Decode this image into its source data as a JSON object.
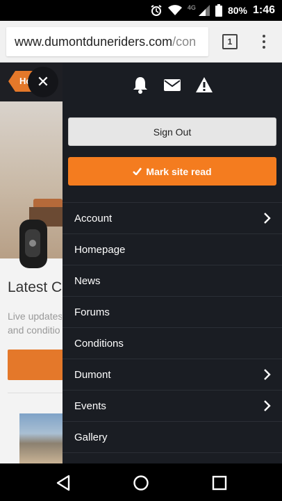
{
  "status_bar": {
    "network_label": "4G",
    "battery_percent": "80%",
    "time": "1:46"
  },
  "browser": {
    "url_main": "www.dumontduneriders.com",
    "url_path": "/con",
    "tab_count": "1"
  },
  "page": {
    "home_label": "Ho",
    "latest_heading": "Latest C",
    "latest_sub_line1": "Live updates",
    "latest_sub_line2": "and conditio"
  },
  "menu": {
    "icons": [
      "bell-icon",
      "envelope-icon",
      "warning-icon"
    ],
    "sign_out_label": "Sign Out",
    "mark_read_label": "Mark site read",
    "items": [
      {
        "label": "Account",
        "has_submenu": true
      },
      {
        "label": "Homepage",
        "has_submenu": false
      },
      {
        "label": "News",
        "has_submenu": false
      },
      {
        "label": "Forums",
        "has_submenu": false
      },
      {
        "label": "Conditions",
        "has_submenu": false
      },
      {
        "label": "Dumont",
        "has_submenu": true
      },
      {
        "label": "Events",
        "has_submenu": true
      },
      {
        "label": "Gallery",
        "has_submenu": false
      }
    ]
  },
  "colors": {
    "menu_bg": "#1a1d23",
    "accent_orange": "#f47c1f",
    "signout_bg": "#e6e6e6"
  }
}
